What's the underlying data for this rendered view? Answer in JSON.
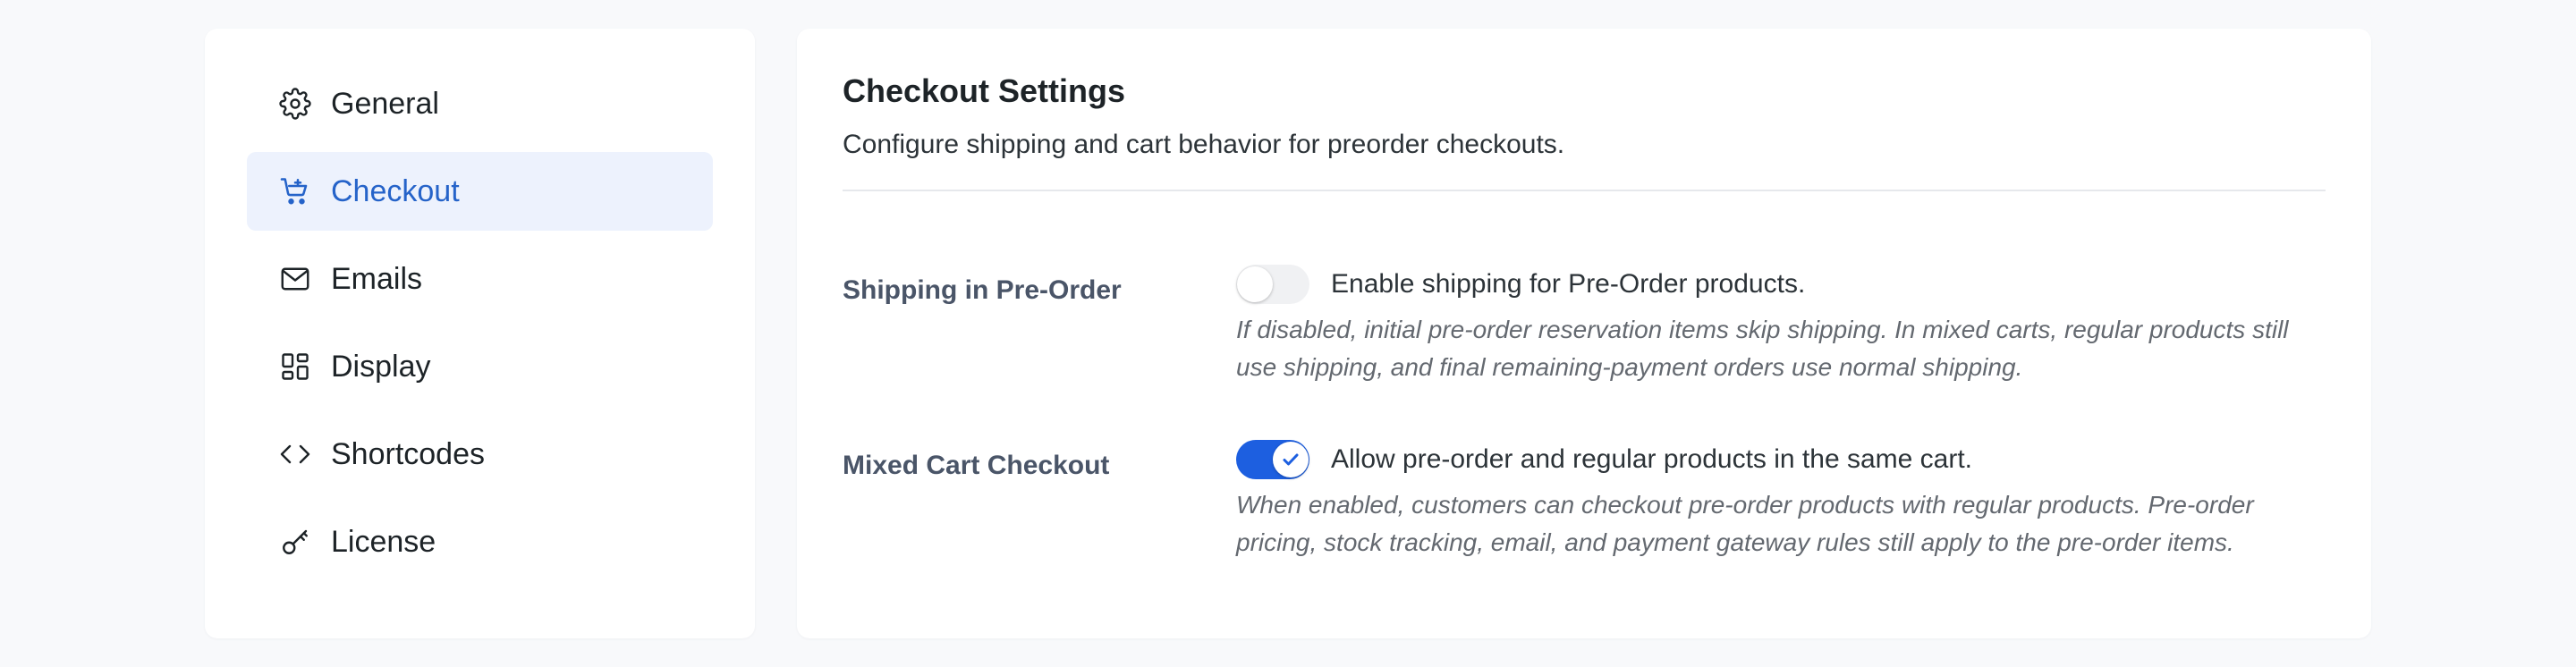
{
  "sidebar": {
    "items": [
      {
        "label": "General",
        "icon": "gear-icon",
        "active": false
      },
      {
        "label": "Checkout",
        "icon": "cart-icon",
        "active": true
      },
      {
        "label": "Emails",
        "icon": "envelope-icon",
        "active": false
      },
      {
        "label": "Display",
        "icon": "layout-icon",
        "active": false
      },
      {
        "label": "Shortcodes",
        "icon": "code-icon",
        "active": false
      },
      {
        "label": "License",
        "icon": "key-icon",
        "active": false
      }
    ]
  },
  "main": {
    "title": "Checkout Settings",
    "description": "Configure shipping and cart behavior for preorder checkouts.",
    "settings": [
      {
        "label": "Shipping in Pre-Order",
        "toggle_label": "Enable shipping for Pre-Order products.",
        "enabled": false,
        "help": "If disabled, initial pre-order reservation items skip shipping. In mixed carts, regular products still use shipping, and final remaining-payment orders use normal shipping."
      },
      {
        "label": "Mixed Cart Checkout",
        "toggle_label": "Allow pre-order and regular products in the same cart.",
        "enabled": true,
        "help": "When enabled, customers can checkout pre-order products with regular products. Pre-order pricing, stock tracking, email, and payment gateway rules still apply to the pre-order items."
      }
    ]
  },
  "colors": {
    "accent": "#2563c9",
    "toggle_on": "#1d5fe0",
    "active_bg": "#edf2fd"
  }
}
